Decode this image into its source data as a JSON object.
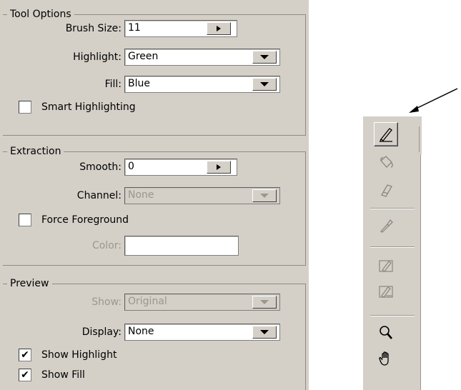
{
  "tool_options": {
    "title": "Tool Options",
    "brush_size_label": "Brush Size:",
    "brush_size_value": "11",
    "highlight_label": "Highlight:",
    "highlight_value": "Green",
    "fill_label": "Fill:",
    "fill_value": "Blue",
    "smart_highlighting_label": "Smart Highlighting",
    "smart_highlighting_checked": false
  },
  "extraction": {
    "title": "Extraction",
    "smooth_label": "Smooth:",
    "smooth_value": "0",
    "channel_label": "Channel:",
    "channel_value": "None",
    "force_foreground_label": "Force Foreground",
    "force_foreground_checked": false,
    "color_label": "Color:",
    "color_value": ""
  },
  "preview": {
    "title": "Preview",
    "show_label": "Show:",
    "show_value": "Original",
    "display_label": "Display:",
    "display_value": "None",
    "show_highlight_label": "Show Highlight",
    "show_highlight_checked": true,
    "show_highlight_mark": "✔",
    "show_fill_label": "Show Fill",
    "show_fill_checked": true,
    "show_fill_mark": "✔"
  },
  "toolbar": {
    "tools": [
      "edge-highlighter-icon",
      "fill-bucket-icon",
      "eraser-icon",
      "eyedropper-icon",
      "cleanup-icon",
      "edge-touchup-icon",
      "zoom-icon",
      "hand-icon"
    ],
    "active_tool": "edge-highlighter-icon"
  }
}
